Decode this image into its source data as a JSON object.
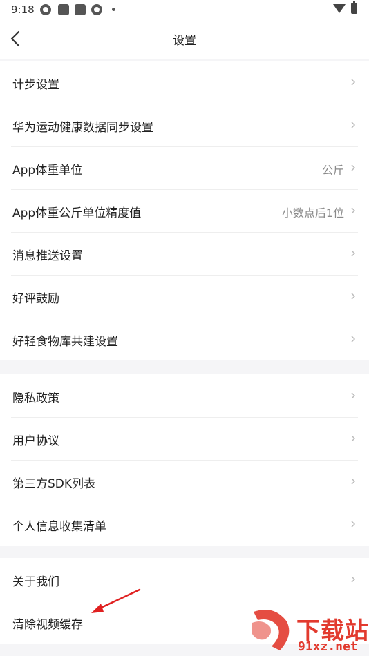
{
  "status_bar": {
    "time": "9:18"
  },
  "nav": {
    "title": "设置"
  },
  "groups": [
    {
      "items": [
        {
          "label": "计步设置",
          "value": ""
        },
        {
          "label": "华为运动健康数据同步设置",
          "value": ""
        },
        {
          "label": "App体重单位",
          "value": "公斤"
        },
        {
          "label": "App体重公斤单位精度值",
          "value": "小数点后1位"
        },
        {
          "label": "消息推送设置",
          "value": ""
        },
        {
          "label": "好评鼓励",
          "value": ""
        },
        {
          "label": "好轻食物库共建设置",
          "value": ""
        }
      ]
    },
    {
      "items": [
        {
          "label": "隐私政策",
          "value": ""
        },
        {
          "label": "用户协议",
          "value": ""
        },
        {
          "label": "第三方SDK列表",
          "value": ""
        },
        {
          "label": "个人信息收集清单",
          "value": ""
        }
      ]
    },
    {
      "items": [
        {
          "label": "关于我们",
          "value": ""
        },
        {
          "label": "清除视频缓存",
          "value": ""
        }
      ]
    }
  ],
  "watermark": {
    "title": "下载站",
    "site": "91xz.net"
  },
  "colors": {
    "accent_red": "#e23a2e",
    "chevron": "#bbbbbb",
    "value_text": "#8a8a8a"
  }
}
